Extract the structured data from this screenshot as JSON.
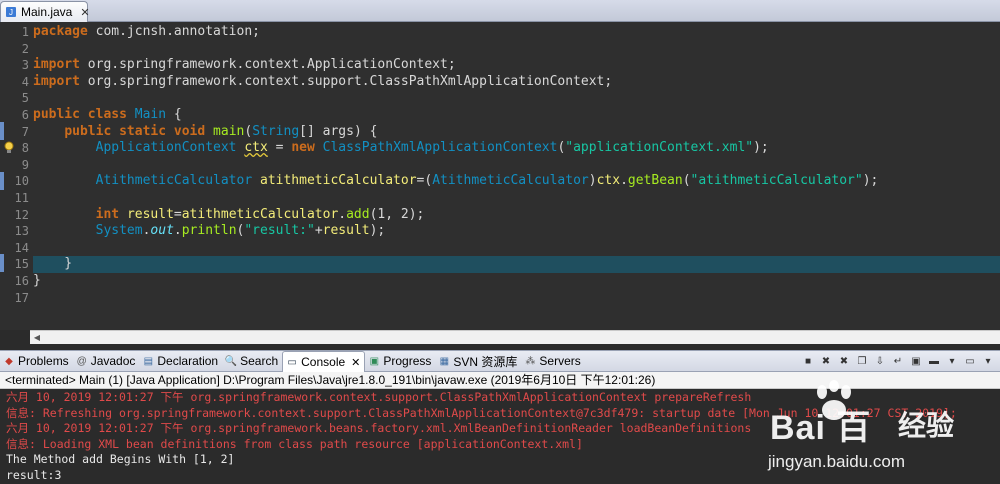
{
  "editor": {
    "tab": {
      "label": "Main.java",
      "close_glyph": "✕"
    },
    "current_line": 15,
    "lines": [
      {
        "no": "1",
        "tokens": [
          {
            "c": "kw",
            "t": "package"
          },
          {
            "c": "plain",
            "t": " com.jcnsh.annotation;"
          }
        ]
      },
      {
        "no": "2",
        "tokens": []
      },
      {
        "no": "3",
        "tokens": [
          {
            "c": "kw",
            "t": "import"
          },
          {
            "c": "plain",
            "t": " org.springframework.context.ApplicationContext;"
          }
        ]
      },
      {
        "no": "4",
        "tokens": [
          {
            "c": "kw",
            "t": "import"
          },
          {
            "c": "plain",
            "t": " org.springframework.context.support.ClassPathXmlApplicationContext;"
          }
        ]
      },
      {
        "no": "5",
        "tokens": []
      },
      {
        "no": "6",
        "tokens": [
          {
            "c": "kw",
            "t": "public"
          },
          {
            "c": "plain",
            "t": " "
          },
          {
            "c": "kw",
            "t": "class"
          },
          {
            "c": "plain",
            "t": " "
          },
          {
            "c": "type",
            "t": "Main"
          },
          {
            "c": "plain",
            "t": " {"
          }
        ]
      },
      {
        "no": "7",
        "tokens": [
          {
            "c": "plain",
            "t": "    "
          },
          {
            "c": "kw",
            "t": "public"
          },
          {
            "c": "plain",
            "t": " "
          },
          {
            "c": "kw",
            "t": "static"
          },
          {
            "c": "plain",
            "t": " "
          },
          {
            "c": "kw",
            "t": "void"
          },
          {
            "c": "plain",
            "t": " "
          },
          {
            "c": "method",
            "t": "main"
          },
          {
            "c": "plain",
            "t": "("
          },
          {
            "c": "type",
            "t": "String"
          },
          {
            "c": "plain",
            "t": "[] args) {"
          }
        ]
      },
      {
        "no": "8",
        "tokens": [
          {
            "c": "plain",
            "t": "        "
          },
          {
            "c": "type",
            "t": "ApplicationContext"
          },
          {
            "c": "plain",
            "t": " "
          },
          {
            "c": "var warn-underline",
            "t": "ctx"
          },
          {
            "c": "plain",
            "t": " = "
          },
          {
            "c": "kw",
            "t": "new"
          },
          {
            "c": "plain",
            "t": " "
          },
          {
            "c": "type",
            "t": "ClassPathXmlApplicationContext"
          },
          {
            "c": "plain",
            "t": "("
          },
          {
            "c": "str",
            "t": "\"applicationContext.xml\""
          },
          {
            "c": "plain",
            "t": ");"
          }
        ]
      },
      {
        "no": "9",
        "tokens": []
      },
      {
        "no": "10",
        "tokens": [
          {
            "c": "plain",
            "t": "        "
          },
          {
            "c": "type",
            "t": "AtithmeticCalculator"
          },
          {
            "c": "plain",
            "t": " "
          },
          {
            "c": "var",
            "t": "atithmeticCalculator"
          },
          {
            "c": "plain",
            "t": "=("
          },
          {
            "c": "type",
            "t": "AtithmeticCalculator"
          },
          {
            "c": "plain",
            "t": ")"
          },
          {
            "c": "var",
            "t": "ctx"
          },
          {
            "c": "plain",
            "t": "."
          },
          {
            "c": "method",
            "t": "getBean"
          },
          {
            "c": "plain",
            "t": "("
          },
          {
            "c": "str",
            "t": "\"atithmeticCalculator\""
          },
          {
            "c": "plain",
            "t": ");"
          }
        ]
      },
      {
        "no": "11",
        "tokens": []
      },
      {
        "no": "12",
        "tokens": [
          {
            "c": "plain",
            "t": "        "
          },
          {
            "c": "kw",
            "t": "int"
          },
          {
            "c": "plain",
            "t": " "
          },
          {
            "c": "var",
            "t": "result"
          },
          {
            "c": "plain",
            "t": "="
          },
          {
            "c": "var",
            "t": "atithmeticCalculator"
          },
          {
            "c": "plain",
            "t": "."
          },
          {
            "c": "method",
            "t": "add"
          },
          {
            "c": "plain",
            "t": "(1, 2);"
          }
        ]
      },
      {
        "no": "13",
        "tokens": [
          {
            "c": "plain",
            "t": "        "
          },
          {
            "c": "type",
            "t": "System"
          },
          {
            "c": "plain",
            "t": "."
          },
          {
            "c": "field",
            "t": "out"
          },
          {
            "c": "plain",
            "t": "."
          },
          {
            "c": "method",
            "t": "println"
          },
          {
            "c": "plain",
            "t": "("
          },
          {
            "c": "str",
            "t": "\"result:\""
          },
          {
            "c": "plain",
            "t": "+"
          },
          {
            "c": "var",
            "t": "result"
          },
          {
            "c": "plain",
            "t": ");"
          }
        ]
      },
      {
        "no": "14",
        "tokens": []
      },
      {
        "no": "15",
        "tokens": [
          {
            "c": "plain",
            "t": "    }"
          }
        ]
      },
      {
        "no": "16",
        "tokens": [
          {
            "c": "plain",
            "t": "}"
          }
        ]
      },
      {
        "no": "17",
        "tokens": []
      }
    ]
  },
  "views": {
    "tabs": [
      {
        "name": "problems",
        "label": "Problems",
        "icon": "problems-icon",
        "glyph": "◆",
        "color": "#c0392b"
      },
      {
        "name": "javadoc",
        "label": "Javadoc",
        "icon": "javadoc-icon",
        "glyph": "@",
        "color": "#555555"
      },
      {
        "name": "declaration",
        "label": "Declaration",
        "icon": "declaration-icon",
        "glyph": "▤",
        "color": "#3b6aa0"
      },
      {
        "name": "search",
        "label": "Search",
        "icon": "search-icon",
        "glyph": "🔍",
        "color": "#555555"
      },
      {
        "name": "console",
        "label": "Console",
        "icon": "console-icon",
        "glyph": "▭",
        "color": "#2c3e50",
        "active": true
      },
      {
        "name": "progress",
        "label": "Progress",
        "icon": "progress-icon",
        "glyph": "▣",
        "color": "#2e8b57"
      },
      {
        "name": "svn",
        "label": "SVN 资源库",
        "icon": "svn-icon",
        "glyph": "▦",
        "color": "#3b6aa0"
      },
      {
        "name": "servers",
        "label": "Servers",
        "icon": "servers-icon",
        "glyph": "⁂",
        "color": "#555555"
      }
    ],
    "close_glyph": "✕",
    "toolbar": [
      {
        "name": "terminate-icon",
        "glyph": "■"
      },
      {
        "name": "remove-launch-icon",
        "glyph": "✖"
      },
      {
        "name": "remove-all-icon",
        "glyph": "✖"
      },
      {
        "name": "copy-icon",
        "glyph": "❐"
      },
      {
        "name": "scroll-lock-icon",
        "glyph": "⇩"
      },
      {
        "name": "word-wrap-icon",
        "glyph": "↵"
      },
      {
        "name": "pin-icon",
        "glyph": "▣"
      },
      {
        "name": "display-console-icon",
        "glyph": "▬"
      },
      {
        "name": "open-console-icon",
        "glyph": "▾"
      },
      {
        "name": "minimize-icon",
        "glyph": "▭"
      },
      {
        "name": "view-menu-icon",
        "glyph": "▾"
      }
    ]
  },
  "console": {
    "header": "<terminated> Main (1) [Java Application] D:\\Program Files\\Java\\jre1.8.0_191\\bin\\javaw.exe (2019年6月10日 下午12:01:26)",
    "lines": [
      {
        "c": "err",
        "t": "六月 10, 2019 12:01:27 下午 org.springframework.context.support.ClassPathXmlApplicationContext prepareRefresh"
      },
      {
        "c": "err",
        "t": "信息: Refreshing org.springframework.context.support.ClassPathXmlApplicationContext@7c3df479: startup date [Mon Jun 10 12:01:27 CST 2019];"
      },
      {
        "c": "err",
        "t": "六月 10, 2019 12:01:27 下午 org.springframework.beans.factory.xml.XmlBeanDefinitionReader loadBeanDefinitions"
      },
      {
        "c": "err",
        "t": "信息: Loading XML bean definitions from class path resource [applicationContext.xml]"
      },
      {
        "c": "out",
        "t": "The Method add Begins With [1, 2]"
      },
      {
        "c": "out",
        "t": "result:3"
      }
    ]
  },
  "watermark": {
    "brand": "Bai  百",
    "jingyan": "经验",
    "url": "jingyan.baidu.com"
  }
}
